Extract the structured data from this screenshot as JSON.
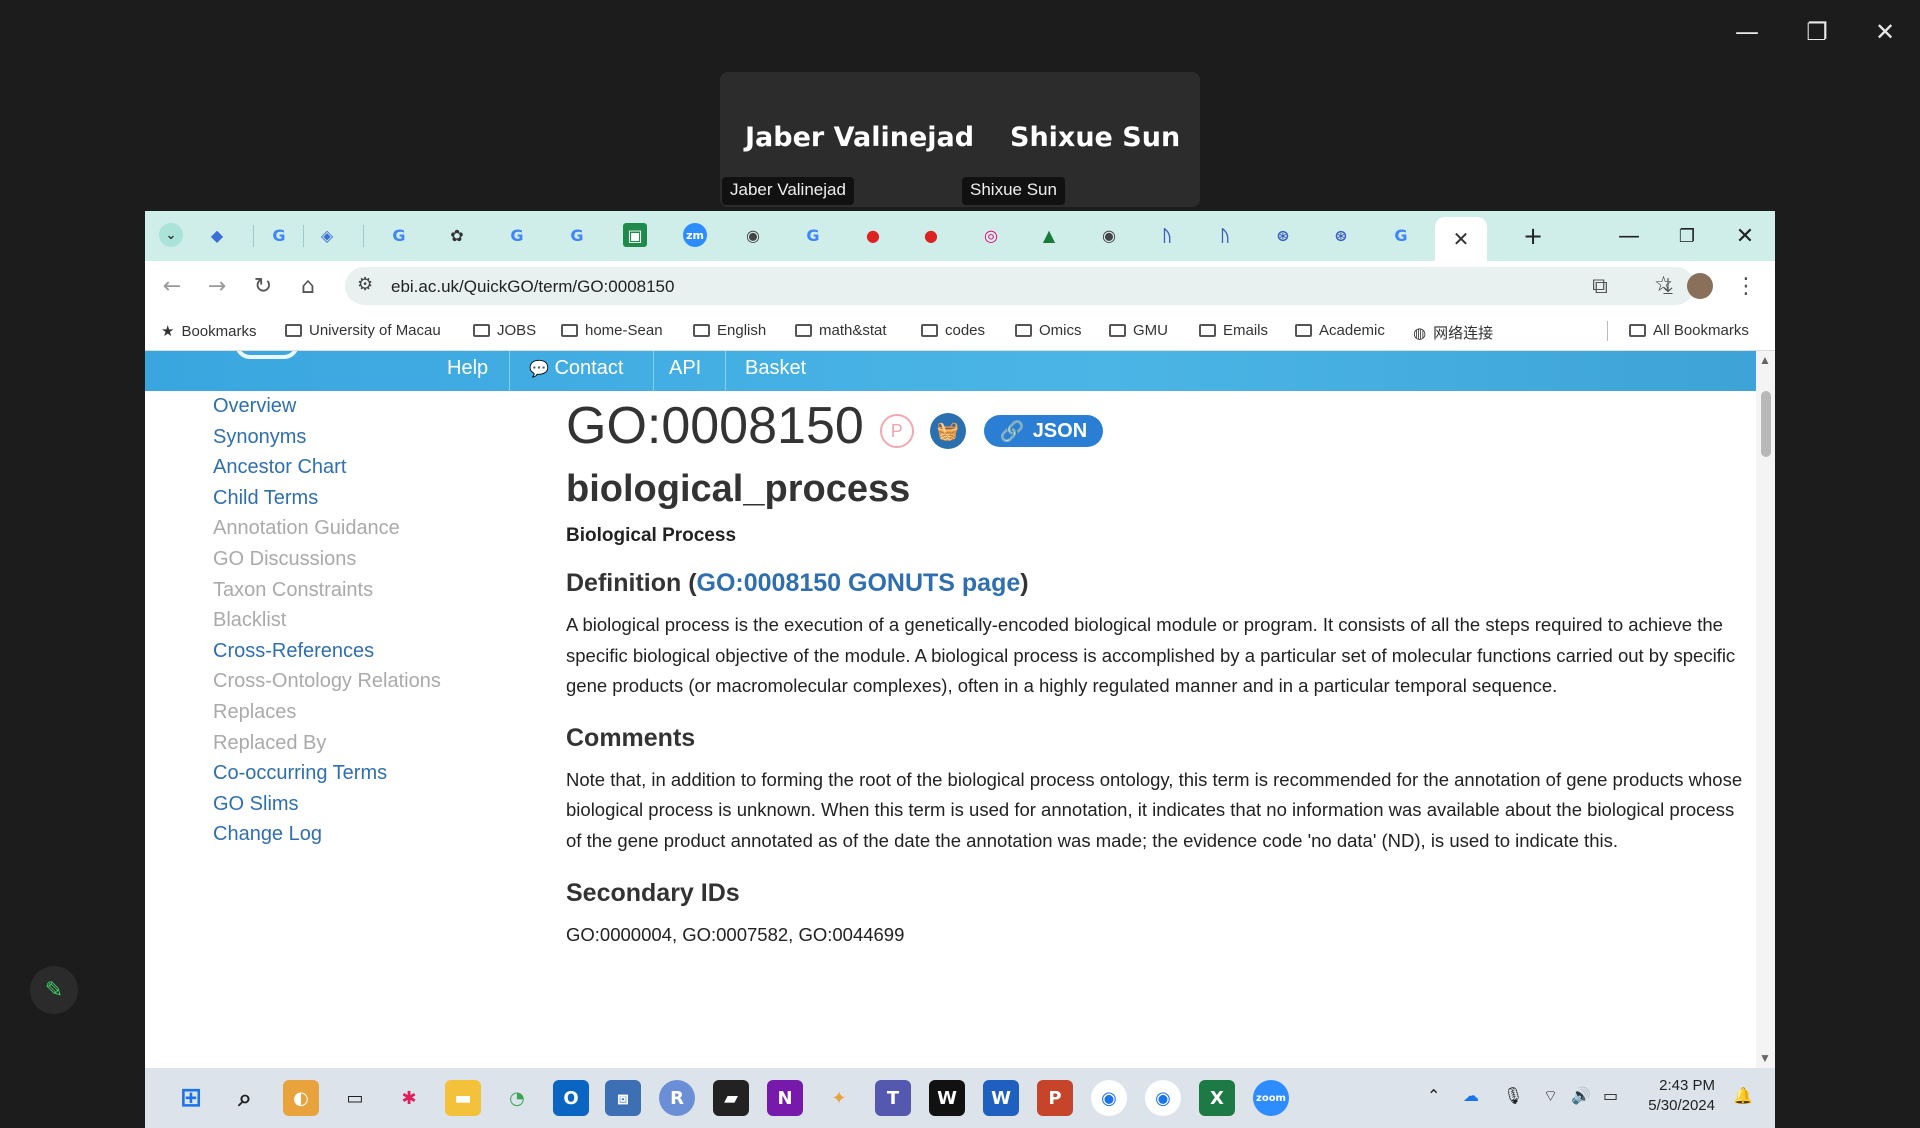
{
  "outer_window": {
    "minimize": "—",
    "restore": "❐",
    "close": "✕"
  },
  "zoom": {
    "participants": [
      {
        "display_name": "Jaber Valinejad",
        "tag": "Jaber Valinejad"
      },
      {
        "display_name": "Shixue Sun",
        "tag": "Shixue Sun"
      }
    ]
  },
  "browser": {
    "active_tab_close": "✕",
    "new_tab": "+",
    "address": "ebi.ac.uk/QuickGO/term/GO:0008150",
    "bookmarks": [
      "Bookmarks",
      "University of Macau",
      "JOBS",
      "home-Sean",
      "English",
      "math&stat",
      "codes",
      "Omics",
      "GMU",
      "Emails",
      "Academic",
      "网络连接"
    ],
    "all_bookmarks": "All Bookmarks"
  },
  "site_nav": {
    "help": "Help",
    "contact": "Contact",
    "api": "API",
    "basket": "Basket"
  },
  "sidebar": {
    "items": [
      {
        "label": "Overview",
        "enabled": true
      },
      {
        "label": "Synonyms",
        "enabled": true
      },
      {
        "label": "Ancestor Chart",
        "enabled": true
      },
      {
        "label": "Child Terms",
        "enabled": true
      },
      {
        "label": "Annotation Guidance",
        "enabled": false
      },
      {
        "label": "GO Discussions",
        "enabled": false
      },
      {
        "label": "Taxon Constraints",
        "enabled": false
      },
      {
        "label": "Blacklist",
        "enabled": false
      },
      {
        "label": "Cross-References",
        "enabled": true
      },
      {
        "label": "Cross-Ontology Relations",
        "enabled": false
      },
      {
        "label": "Replaces",
        "enabled": false
      },
      {
        "label": "Replaced By",
        "enabled": false
      },
      {
        "label": "Co-occurring Terms",
        "enabled": true
      },
      {
        "label": "GO Slims",
        "enabled": true
      },
      {
        "label": "Change Log",
        "enabled": true
      }
    ]
  },
  "term": {
    "id": "GO:0008150",
    "p_badge": "P",
    "json_label": "JSON",
    "name": "biological_process",
    "label": "Biological Process",
    "definition_heading": "Definition (",
    "definition_link": "GO:0008150 GONUTS page",
    "definition_heading_close": ")",
    "definition": "A biological process is the execution of a genetically-encoded biological module or program. It consists of all the steps required to achieve the specific biological objective of the module. A biological process is accomplished by a particular set of molecular functions carried out by specific gene products (or macromolecular complexes), often in a highly regulated manner and in a particular temporal sequence.",
    "comments_heading": "Comments",
    "comments": "Note that, in addition to forming the root of the biological process ontology, this term is recommended for the annotation of gene products whose biological process is unknown. When this term is used for annotation, it indicates that no information was available about the biological process of the gene product annotated as of the date the annotation was made; the evidence code 'no data' (ND), is used to indicate this.",
    "secondary_heading": "Secondary IDs",
    "secondary_ids": "GO:0000004, GO:0007582, GO:0044699"
  },
  "taskbar": {
    "time": "2:43 PM",
    "date": "5/30/2024"
  },
  "colors": {
    "accent": "#2f6fb0",
    "nav_bar": "#3aa6df",
    "json_button": "#2a7fd4",
    "tabstrip": "#cfeee9"
  }
}
